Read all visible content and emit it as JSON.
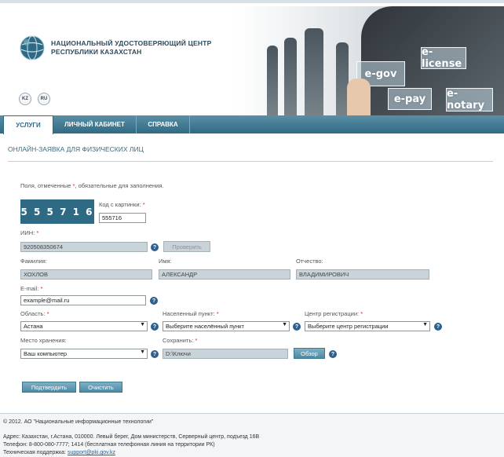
{
  "header": {
    "org_line1": "НАЦИОНАЛЬНЫЙ УДОСТОВЕРЯЮЩИЙ ЦЕНТР",
    "org_line2": "РЕСПУБЛИКИ КАЗАХСТАН",
    "lang_kz": "KZ",
    "lang_ru": "RU",
    "logo_icon": "globe-logo-icon",
    "banner_tiles": [
      "e-license",
      "e-gov",
      "e-pay",
      "e-notary"
    ]
  },
  "nav": {
    "tabs": [
      {
        "label": "УСЛУГИ",
        "active": true
      },
      {
        "label": "ЛИЧНЫЙ КАБИНЕТ",
        "active": false
      },
      {
        "label": "СПРАВКА",
        "active": false
      }
    ]
  },
  "page": {
    "heading": "ОНЛАЙН-ЗАЯВКА ДЛЯ ФИЗИЧЕСКИХ ЛИЦ",
    "note_before": "Поля, отмеченные ",
    "note_star": "*",
    "note_after": ", обязательные для заполнения."
  },
  "form": {
    "captcha_text": "5 5 5 7 1 6",
    "captcha_label": "Код с картинки:",
    "captcha_value": "555716",
    "iin_label": "ИИН:",
    "iin_value": "920508350674",
    "check_button": "Проверить",
    "surname_label": "Фамилия:",
    "surname_value": "ХОХЛОВ",
    "name_label": "Имя:",
    "name_value": "АЛЕКСАНДР",
    "patronymic_label": "Отчество:",
    "patronymic_value": "ВЛАДИМИРОВИЧ",
    "email_label": "E-mail:",
    "email_value": "example@mail.ru",
    "region_label": "Область:",
    "region_value": "Астана",
    "locality_label": "Населенный пункт:",
    "locality_value": "Выберите населённый пункт",
    "center_label": "Центр регистрации:",
    "center_value": "Выберите центр регистрации",
    "storage_label": "Место хранения:",
    "storage_value": "Ваш компьютер",
    "save_label": "Сохранить:",
    "save_value": "D:\\Ключи",
    "browse_button": "Обзор",
    "submit_button": "Подтвердить",
    "clear_button": "Очистить",
    "required_star": "*",
    "help_glyph": "?",
    "select_arrow": "▼"
  },
  "footer": {
    "copyright": "© 2012. АО \"Национальные информационные технологии\"",
    "address": "Адрес: Казахстан, г.Астана, 010000. Левый берег, Дом министерств, Серверный центр, подъезд 16В",
    "phone": "Телефон: 8-800-080-7777; 1414 (бесплатная телефонная линия на территории РК)",
    "support_label": "Техническая поддержка:",
    "support_email": "support@pki.gov.kz"
  },
  "colors": {
    "nav_bg": "#2f6a83",
    "accent": "#2c5f8c",
    "required": "#d9262d",
    "readonly_bg": "#c9d4da"
  }
}
